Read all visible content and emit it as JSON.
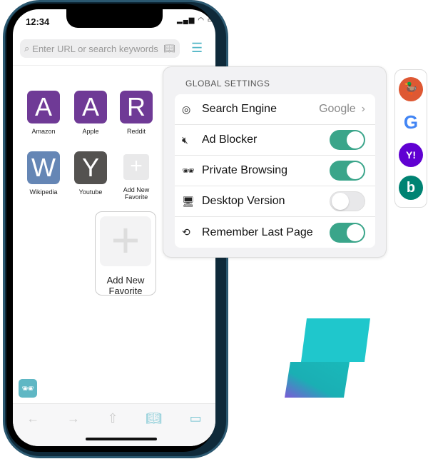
{
  "status": {
    "time": "12:34",
    "indicators": "signal wifi battery"
  },
  "urlbar": {
    "placeholder": "Enter URL or search keywords"
  },
  "favorites": [
    {
      "letter": "A",
      "label": "Amazon",
      "color": "#6f3a96"
    },
    {
      "letter": "A",
      "label": "Apple",
      "color": "#6f3a96"
    },
    {
      "letter": "R",
      "label": "Reddit",
      "color": "#6f3a96"
    },
    {
      "letter": "W",
      "label": "Wikipedia",
      "color": "#6586b5"
    },
    {
      "letter": "Y",
      "label": "Youtube",
      "color": "#545250"
    }
  ],
  "add_favorite": {
    "label_small": "Add New Favorite",
    "label_line1": "Add New",
    "label_line2": "Favorite"
  },
  "settings": {
    "title": "GLOBAL SETTINGS",
    "search_engine": {
      "label": "Search Engine",
      "value": "Google"
    },
    "ad_blocker": {
      "label": "Ad Blocker",
      "on": true
    },
    "private_browsing": {
      "label": "Private Browsing",
      "on": true
    },
    "desktop_version": {
      "label": "Desktop Version",
      "on": false
    },
    "remember_last_page": {
      "label": "Remember Last Page",
      "on": true
    }
  },
  "engines": [
    {
      "name": "duckduckgo",
      "glyph": "🦆",
      "color": "#de5833"
    },
    {
      "name": "google",
      "glyph": "G",
      "color": "#ffffff"
    },
    {
      "name": "yahoo",
      "glyph": "Y!",
      "color": "#6001d2"
    },
    {
      "name": "bing",
      "glyph": "b",
      "color": "#008373"
    }
  ],
  "colors": {
    "accent": "#3aa58a",
    "toolbar_icon": "#7fc8d4"
  }
}
